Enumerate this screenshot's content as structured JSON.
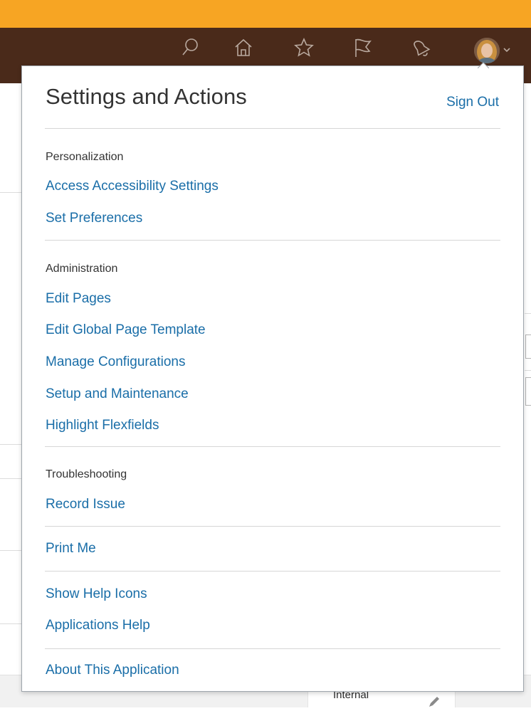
{
  "header": {
    "icons": [
      "search-icon",
      "home-icon",
      "star-icon",
      "flag-icon",
      "bell-icon"
    ],
    "colors": {
      "accent_bar": "#f7a523",
      "header_bg": "#4a2a1a",
      "link": "#1a6ea8"
    }
  },
  "popup": {
    "title": "Settings and Actions",
    "sign_out": "Sign Out",
    "sections": {
      "personalization": {
        "heading": "Personalization",
        "items": [
          "Access Accessibility Settings",
          "Set Preferences"
        ]
      },
      "administration": {
        "heading": "Administration",
        "items": [
          "Edit Pages",
          "Edit Global Page Template",
          "Manage Configurations",
          "Setup and Maintenance",
          "Highlight Flexfields"
        ]
      },
      "troubleshooting": {
        "heading": "Troubleshooting",
        "items": [
          "Record Issue"
        ]
      },
      "print": {
        "items": [
          "Print Me"
        ]
      },
      "help": {
        "items": [
          "Show Help Icons",
          "Applications Help"
        ]
      },
      "about": {
        "items": [
          "About This Application"
        ]
      }
    }
  },
  "background": {
    "card_label": "Internal"
  }
}
